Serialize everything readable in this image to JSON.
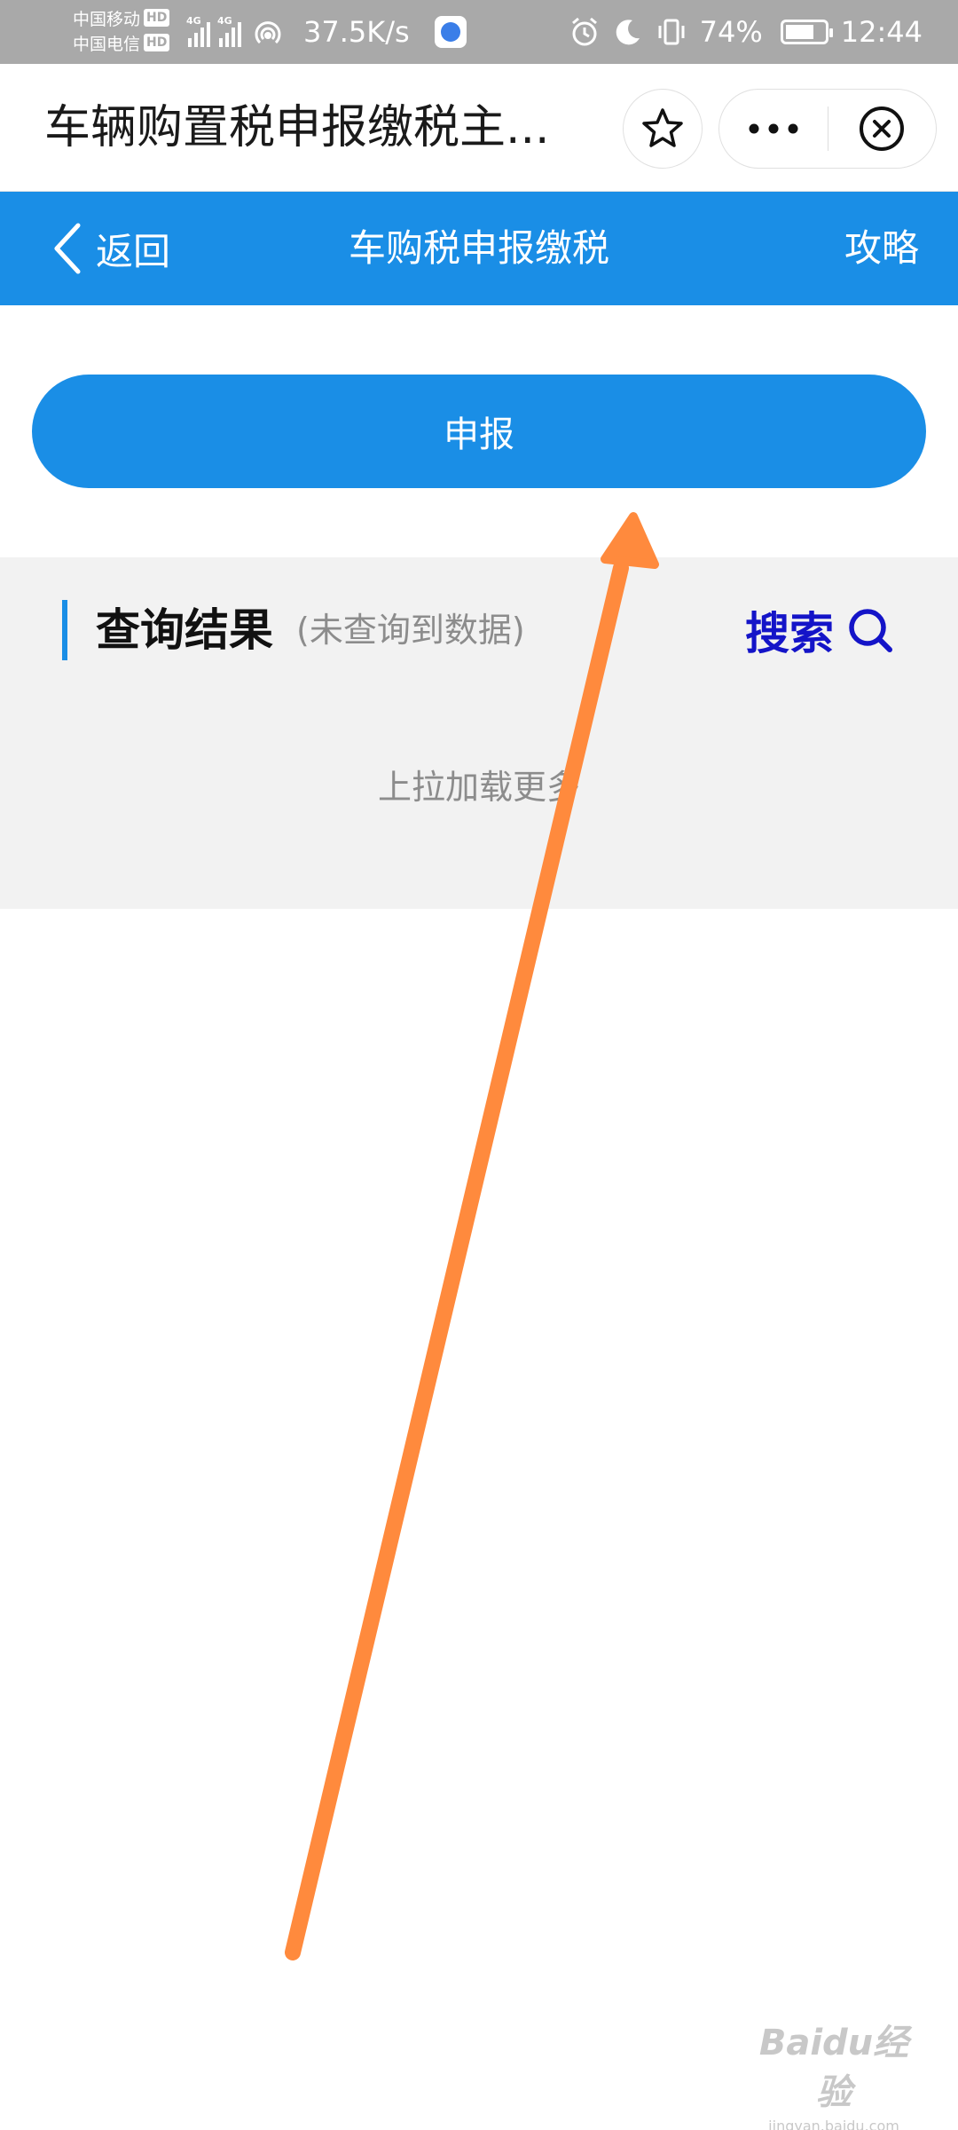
{
  "status_bar": {
    "carrier1": "中国移动",
    "carrier2": "中国电信",
    "hd_badge": "HD",
    "network": "4G",
    "net_speed": "37.5K/s",
    "battery_percent": "74%",
    "battery_level": 0.74,
    "time": "12:44",
    "icons": [
      "signal-icon",
      "hotspot-icon",
      "app-notification-icon",
      "alarm-icon",
      "moon-icon",
      "vibrate-icon",
      "battery-icon"
    ]
  },
  "title_bar": {
    "title": "车辆购置税申报缴税主...",
    "icons": [
      "star-icon",
      "more-dots-icon",
      "close-circle-icon"
    ]
  },
  "nav_bar": {
    "back_label": "返回",
    "title": "车购税申报缴税",
    "guide_label": "攻略",
    "color": "#1a8ee6"
  },
  "declare_button": {
    "label": "申报"
  },
  "results": {
    "title": "查询结果",
    "hint": "(未查询到数据)",
    "search_label": "搜索",
    "load_more": "上拉加载更多",
    "search_color": "#1414c8"
  },
  "annotation": {
    "arrow_color": "#ff8a3d"
  },
  "watermark": {
    "text": "Baidu经验",
    "url": "jingyan.baidu.com"
  }
}
